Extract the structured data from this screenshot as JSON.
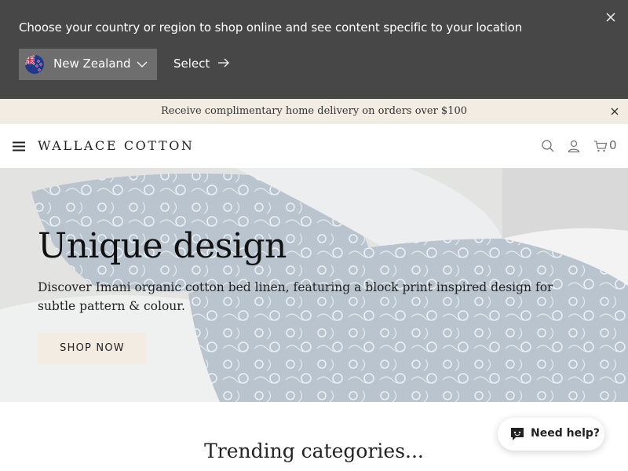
{
  "country_bar": {
    "message": "Choose your country or region to shop online and see content specific to your location",
    "selected_country": "New Zealand",
    "select_label": "Select"
  },
  "promo": {
    "text": "Receive complimentary home delivery on orders over $100"
  },
  "header": {
    "logo": "WALLACE COTTON",
    "cart_count": "0"
  },
  "hero": {
    "title": "Unique design",
    "subtitle": "Discover Imani organic cotton bed linen, featuring a block print inspired design for subtle pattern & colour.",
    "button_label": "SHOP NOW"
  },
  "trending": {
    "title": "Trending categories..."
  },
  "help": {
    "label": "Need help?"
  },
  "colors": {
    "country_bar_bg": "#474747",
    "promo_bg": "#f2ece3",
    "button_bg": "#f3ece3"
  },
  "icons": [
    "close-icon",
    "nz-flag-icon",
    "chevron-down-icon",
    "arrow-right-icon",
    "hamburger-icon",
    "search-icon",
    "account-icon",
    "cart-icon",
    "chat-icon"
  ]
}
